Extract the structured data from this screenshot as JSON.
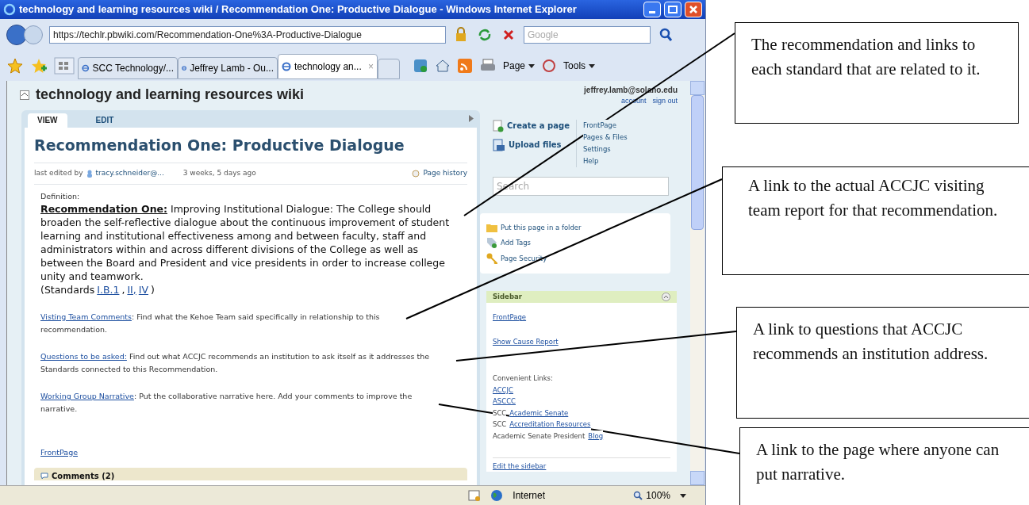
{
  "window": {
    "title": "technology and learning resources wiki / Recommendation One: Productive Dialogue - Windows Internet Explorer"
  },
  "address_bar": {
    "url": "https://techlr.pbwiki.com/Recommendation-One%3A-Productive-Dialogue",
    "search_placeholder": "Google"
  },
  "browser_tabs": [
    {
      "label": "SCC Technology/...",
      "selected": false
    },
    {
      "label": "Jeffrey Lamb - Ou...",
      "selected": false
    },
    {
      "label": "technology an...",
      "selected": true,
      "close": "×"
    }
  ],
  "command_bar": [
    {
      "kind": "icon"
    },
    {
      "kind": "icon"
    },
    {
      "kind": "icon"
    },
    {
      "kind": "icon"
    },
    {
      "kind": "menu",
      "label": "Page"
    },
    {
      "kind": "icon"
    },
    {
      "kind": "menu",
      "label": "Tools"
    }
  ],
  "wiki": {
    "title": "technology and learning resources wiki",
    "user": "jeffrey.lamb@solano.edu",
    "user_links": [
      "account",
      "sign out"
    ]
  },
  "page_tabs": [
    {
      "label": "VIEW",
      "selected": true
    },
    {
      "label": "EDIT",
      "selected": false
    }
  ],
  "page": {
    "heading": "Recommendation One: Productive Dialogue",
    "edited_label": "last edited by",
    "editor": "tracy.schneider@...",
    "edited_when": "3 weeks, 5 days ago",
    "history": "Page history",
    "definition_label": "Definition:",
    "rec_lead": "Recommendation One:",
    "rec_text": "Improving Institutional Dialogue: The College should broaden the self-reflective dialogue about the continuous improvement of student learning and institutional effectiveness among and between faculty, staff and administrators within and across different divisions of the College as well as between the Board and President and vice presidents in order to increase college unity and teamwork.",
    "standards": [
      {
        "kind": "text",
        "text": "(Standards"
      },
      {
        "kind": "link",
        "text": "I.B.1"
      },
      {
        "kind": "text",
        "text": ","
      },
      {
        "kind": "link",
        "text": "II,"
      },
      {
        "kind": "link",
        "text": "IV"
      },
      {
        "kind": "text",
        "text": ")"
      }
    ],
    "sections": [
      {
        "link": "Visting Team Comments",
        "text": ":  Find what the Kehoe Team said specifically in relationship to this recommendation."
      },
      {
        "link": "Questions to be asked:",
        "text": " Find out what ACCJC recommends an institution to ask itself as it addresses the Standards connected to this Recommendation."
      },
      {
        "link": "Working Group Narrative",
        "text": ":  Put the collaborative narrative here.  Add your comments to improve the narrative."
      }
    ],
    "footer_link": "FrontPage",
    "comments": "Comments (2)"
  },
  "actions": {
    "primary": [
      {
        "label": "Create a page"
      },
      {
        "label": "Upload files"
      }
    ],
    "links": [
      "FrontPage",
      "Pages & Files",
      "Settings",
      "Help"
    ],
    "search_placeholder": "Search",
    "page_tools": [
      {
        "label": "Put this page in a folder"
      },
      {
        "label": "Add Tags"
      },
      {
        "label": "Page Security"
      }
    ]
  },
  "sidebar": {
    "title": "Sidebar",
    "expanded": true,
    "top_links": [
      "FrontPage",
      "Show Cause Report"
    ],
    "links_label": "Convenient Links:",
    "lines": [
      {
        "link": "ACCJC"
      },
      {
        "link": "ASCCC"
      },
      {
        "prefix": "SCC",
        "link": "Academic Senate"
      },
      {
        "prefix": "SCC",
        "link": "Accreditation Resources"
      },
      {
        "prefix": "Academic Senate President",
        "link": "Blog"
      }
    ],
    "edit": "Edit the sidebar"
  },
  "status_bar": {
    "zone": "Internet",
    "zoom": "100%"
  },
  "annotations": [
    {
      "text": "The recommendation and links to each standard that are related to it."
    },
    {
      "text": "A link to the actual ACCJC visiting team report for that recommendation."
    },
    {
      "text": "A link to questions that ACCJC recommends an institution address."
    },
    {
      "text": "A link to the page where anyone can put narrative."
    }
  ]
}
